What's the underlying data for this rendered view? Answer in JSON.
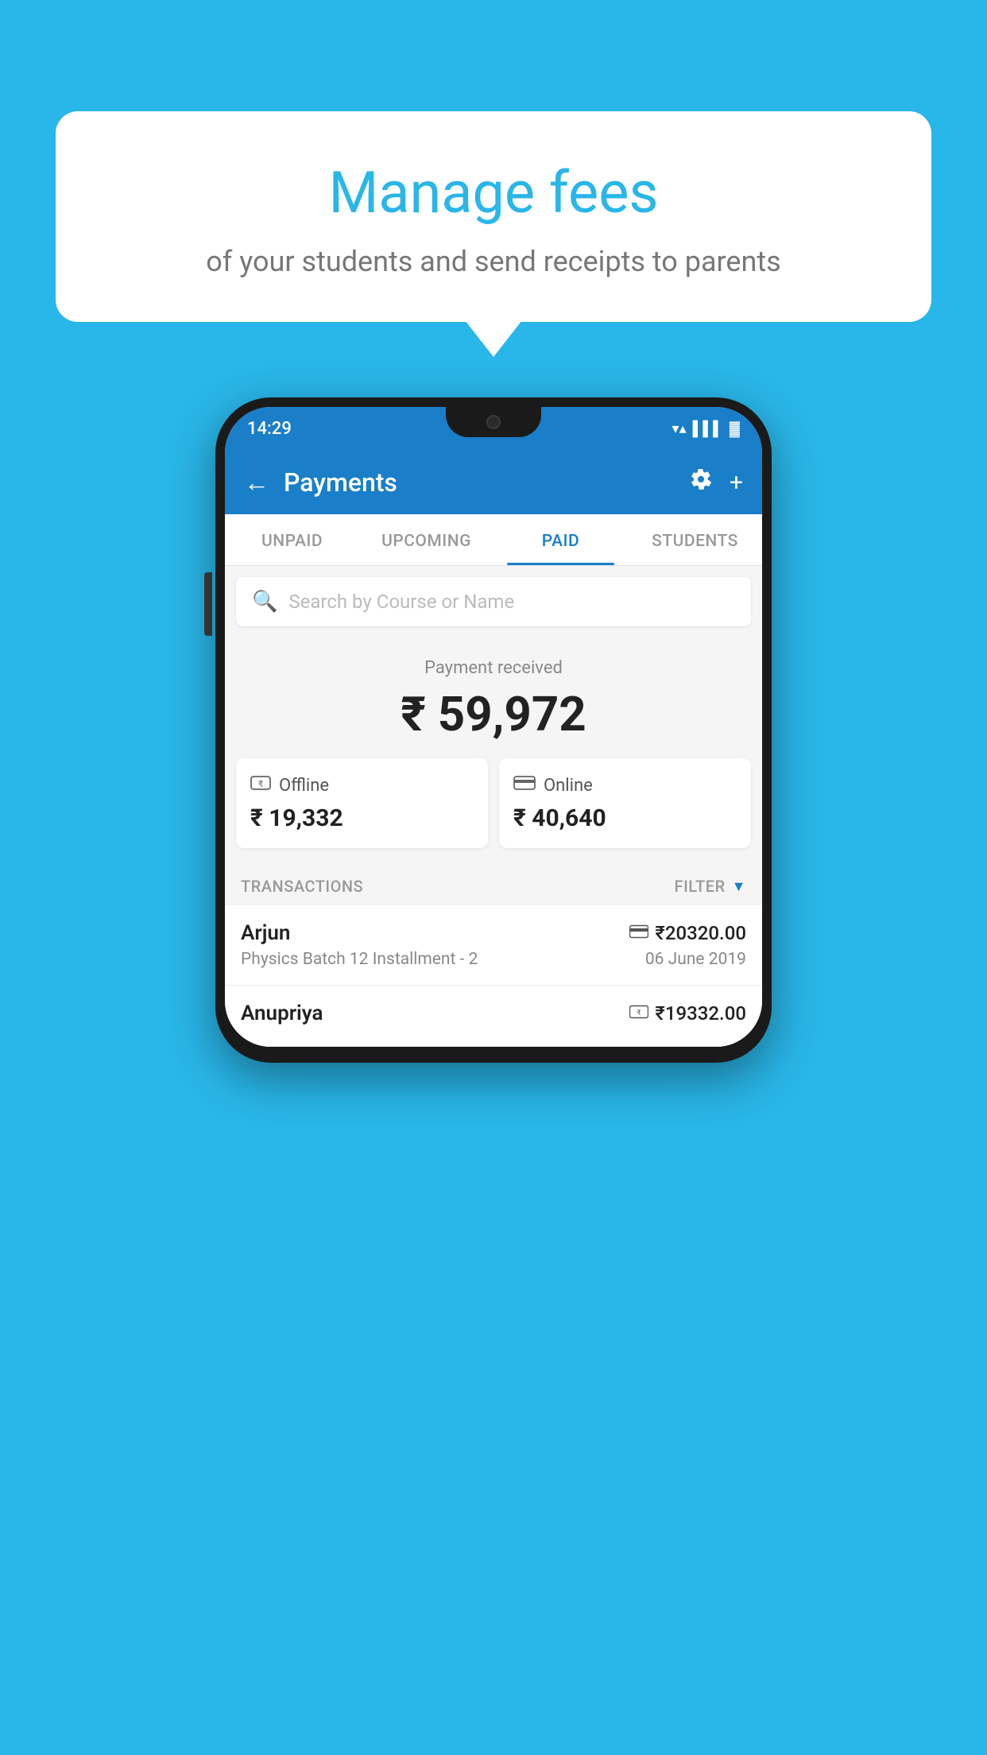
{
  "background_color": "#29b6e8",
  "bubble": {
    "title": "Manage fees",
    "subtitle": "of your students and send receipts to parents"
  },
  "status_bar": {
    "time": "14:29"
  },
  "app_bar": {
    "title": "Payments",
    "back_label": "←",
    "plus_label": "+"
  },
  "tabs": [
    {
      "label": "UNPAID",
      "active": false
    },
    {
      "label": "UPCOMING",
      "active": false
    },
    {
      "label": "PAID",
      "active": true
    },
    {
      "label": "STUDENTS",
      "active": false
    }
  ],
  "search": {
    "placeholder": "Search by Course or Name"
  },
  "payment_summary": {
    "label": "Payment received",
    "total": "₹ 59,972",
    "offline": {
      "type": "Offline",
      "amount": "₹ 19,332"
    },
    "online": {
      "type": "Online",
      "amount": "₹ 40,640"
    }
  },
  "transactions_section": {
    "label": "TRANSACTIONS",
    "filter_label": "FILTER"
  },
  "transactions": [
    {
      "name": "Arjun",
      "amount": "₹20320.00",
      "payment_mode": "card",
      "course": "Physics Batch 12 Installment - 2",
      "date": "06 June 2019"
    },
    {
      "name": "Anupriya",
      "amount": "₹19332.00",
      "payment_mode": "cash",
      "course": "",
      "date": ""
    }
  ]
}
